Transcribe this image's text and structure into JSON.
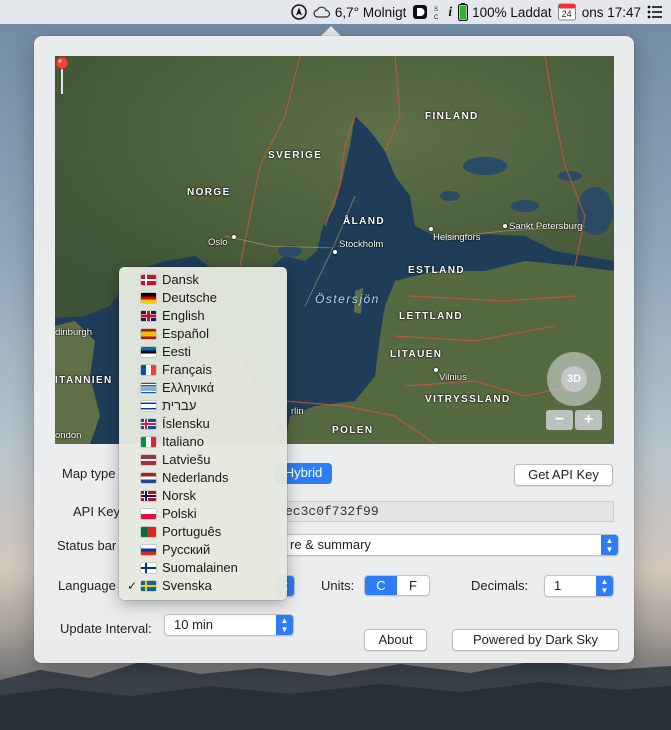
{
  "menubar": {
    "weather": "6,7° Molnigt",
    "battery": "100% Laddat",
    "calendar_day": "24",
    "clock": "ons 17:47"
  },
  "map": {
    "countries": [
      "FINLAND",
      "SVERIGE",
      "NORGE",
      "ÅLAND",
      "ESTLAND",
      "LETTLAND",
      "LITAUEN",
      "VITRYSSLAND",
      "POLEN",
      "ITANNIEN"
    ],
    "cities": [
      "Oslo",
      "Stockholm",
      "Helsingfors",
      "Sankt Petersburg",
      "Vilnius",
      "dinburgh",
      "rlin",
      "ondon"
    ],
    "sea": "Östersjön",
    "compass_label": "3D",
    "zoom_out": "−",
    "zoom_in": "+"
  },
  "form": {
    "map_type_label": "Map type",
    "map_type_value": "Hybrid",
    "get_api_key": "Get API Key",
    "api_key_label": "API Key",
    "api_key_value": "ec3c0f732f99",
    "status_bar_label": "Status bar",
    "status_bar_value": "re & summary",
    "language_label": "Language",
    "units_label": "Units:",
    "units_options": [
      "C",
      "F"
    ],
    "units_selected": "C",
    "decimals_label": "Decimals:",
    "decimals_value": "1",
    "update_label": "Update Interval:",
    "update_value": "10 min",
    "about": "About",
    "powered": "Powered by Dark Sky"
  },
  "languages": [
    {
      "label": "Dansk",
      "flag": "dk"
    },
    {
      "label": "Deutsche",
      "flag": "de"
    },
    {
      "label": "English",
      "flag": "gb"
    },
    {
      "label": "Español",
      "flag": "es"
    },
    {
      "label": "Eesti",
      "flag": "ee"
    },
    {
      "label": "Français",
      "flag": "fr"
    },
    {
      "label": "Ελληνικά",
      "flag": "gr"
    },
    {
      "label": "עברית",
      "flag": "il"
    },
    {
      "label": "Íslensku",
      "flag": "is"
    },
    {
      "label": "Italiano",
      "flag": "it"
    },
    {
      "label": "Latviešu",
      "flag": "lv"
    },
    {
      "label": "Nederlands",
      "flag": "nl"
    },
    {
      "label": "Norsk",
      "flag": "no"
    },
    {
      "label": "Polski",
      "flag": "pl"
    },
    {
      "label": "Português",
      "flag": "pt"
    },
    {
      "label": "Русский",
      "flag": "ru"
    },
    {
      "label": "Suomalainen",
      "flag": "fi"
    },
    {
      "label": "Svenska",
      "flag": "se",
      "checked": true
    }
  ],
  "colors": {
    "accent": "#2e7cf6"
  }
}
